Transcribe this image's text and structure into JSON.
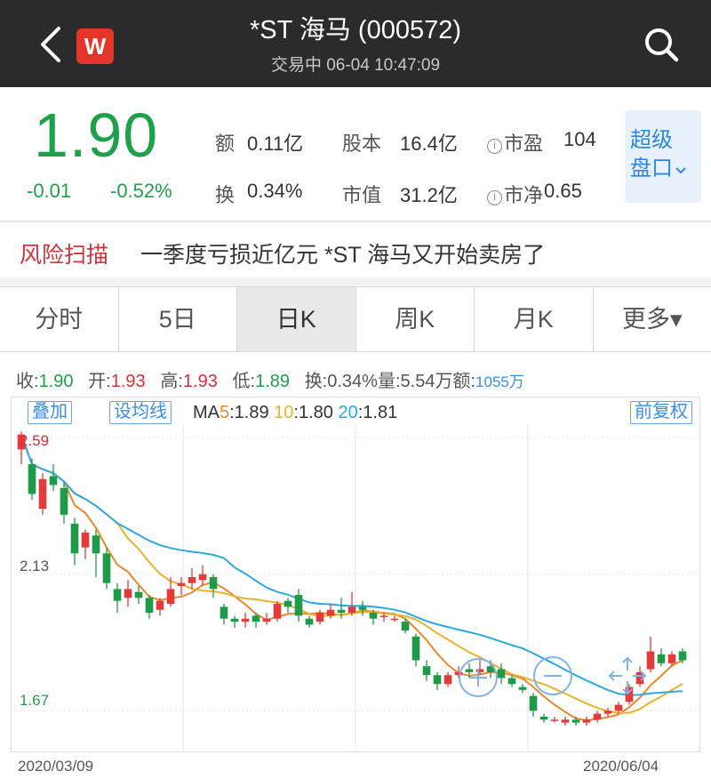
{
  "header": {
    "title": "*ST 海马 (000572)",
    "subtitle": "交易中 06-04 10:47:09",
    "logo_letter": "W"
  },
  "quote": {
    "price": "1.90",
    "change": "-0.01",
    "change_pct": "-0.52%",
    "amount_label": "额",
    "amount": "0.11亿",
    "turnover_label": "换",
    "turnover": "0.34%",
    "capital_label": "股本",
    "capital": "16.4亿",
    "mktcap_label": "市值",
    "mktcap": "31.2亿",
    "pe_label": "市盈",
    "pe": "104",
    "pb_label": "市净",
    "pb": "0.65",
    "info_mark": "i",
    "super_line1": "超级",
    "super_line2": "盘口"
  },
  "news": {
    "tag": "风险扫描",
    "text": "一季度亏损近亿元 *ST 海马又开始卖房了"
  },
  "tabs": [
    "分时",
    "5日",
    "日K",
    "周K",
    "月K",
    "更多▾"
  ],
  "active_tab": 2,
  "stats": {
    "close_label": "收:",
    "close": "1.90",
    "open_label": "开:",
    "open": "1.93",
    "high_label": "高:",
    "high": "1.93",
    "low_label": "低:",
    "low": "1.89",
    "turn_label": "换:",
    "turn": "0.34%",
    "vol_label": "量:",
    "vol": "5.54万",
    "amt_label": "额:",
    "amt": "1055万"
  },
  "chart_controls": {
    "overlay": "叠加",
    "set_ma": "设均线",
    "adjust": "前复权",
    "ma_prefix": "MA",
    "ma5_label": "5",
    "ma5": ":1.89",
    "ma10_label": "10",
    "ma10": ":1.80",
    "ma20_label": "20",
    "ma20": ":1.81"
  },
  "chart_data": {
    "type": "candlestick",
    "y_ticks": [
      "2.59",
      "2.13",
      "1.67"
    ],
    "x_start": "2020/03/09",
    "x_end": "2020/06/04",
    "ylim": [
      1.56,
      2.62
    ],
    "candles": [
      [
        2.55,
        2.6,
        2.5,
        2.61
      ],
      [
        2.5,
        2.4,
        2.38,
        2.52
      ],
      [
        2.35,
        2.45,
        2.33,
        2.47
      ],
      [
        2.46,
        2.43,
        2.41,
        2.5
      ],
      [
        2.42,
        2.33,
        2.3,
        2.44
      ],
      [
        2.3,
        2.2,
        2.16,
        2.32
      ],
      [
        2.22,
        2.27,
        2.18,
        2.28
      ],
      [
        2.26,
        2.2,
        2.12,
        2.28
      ],
      [
        2.2,
        2.1,
        2.08,
        2.22
      ],
      [
        2.08,
        2.04,
        2.0,
        2.1
      ],
      [
        2.05,
        2.08,
        2.02,
        2.11
      ],
      [
        2.07,
        2.05,
        2.03,
        2.09
      ],
      [
        2.05,
        2.0,
        1.98,
        2.06
      ],
      [
        2.01,
        2.04,
        1.99,
        2.05
      ],
      [
        2.03,
        2.08,
        2.02,
        2.12
      ],
      [
        2.09,
        2.1,
        2.06,
        2.12
      ],
      [
        2.1,
        2.12,
        2.08,
        2.15
      ],
      [
        2.11,
        2.13,
        2.09,
        2.16
      ],
      [
        2.12,
        2.08,
        2.05,
        2.13
      ],
      [
        2.02,
        1.98,
        1.96,
        2.03
      ],
      [
        1.98,
        1.97,
        1.95,
        1.99
      ],
      [
        1.97,
        1.98,
        1.95,
        2.0
      ],
      [
        1.99,
        1.97,
        1.95,
        2.0
      ],
      [
        1.97,
        1.98,
        1.96,
        2.0
      ],
      [
        1.98,
        2.03,
        1.97,
        2.04
      ],
      [
        2.04,
        2.02,
        2.0,
        2.05
      ],
      [
        2.06,
        1.99,
        1.97,
        2.08
      ],
      [
        1.98,
        1.96,
        1.95,
        1.99
      ],
      [
        1.97,
        2.0,
        1.96,
        2.01
      ],
      [
        1.99,
        2.01,
        1.98,
        2.03
      ],
      [
        2.01,
        2.0,
        1.98,
        2.05
      ],
      [
        2.0,
        2.02,
        1.99,
        2.07
      ],
      [
        2.02,
        2.01,
        1.99,
        2.04
      ],
      [
        2.0,
        1.98,
        1.96,
        2.01
      ],
      [
        1.99,
        1.99,
        1.97,
        2.0
      ],
      [
        1.98,
        1.98,
        1.97,
        1.99
      ],
      [
        1.97,
        1.94,
        1.93,
        1.98
      ],
      [
        1.92,
        1.84,
        1.82,
        1.93
      ],
      [
        1.82,
        1.79,
        1.77,
        1.84
      ],
      [
        1.79,
        1.76,
        1.74,
        1.8
      ],
      [
        1.76,
        1.79,
        1.75,
        1.8
      ],
      [
        1.79,
        1.8,
        1.78,
        1.82
      ],
      [
        1.81,
        1.8,
        1.78,
        1.83
      ],
      [
        1.8,
        1.81,
        1.79,
        1.84
      ],
      [
        1.82,
        1.8,
        1.78,
        1.84
      ],
      [
        1.81,
        1.78,
        1.76,
        1.83
      ],
      [
        1.78,
        1.76,
        1.75,
        1.79
      ],
      [
        1.75,
        1.74,
        1.73,
        1.76
      ],
      [
        1.72,
        1.67,
        1.65,
        1.73
      ],
      [
        1.65,
        1.64,
        1.63,
        1.66
      ],
      [
        1.64,
        1.64,
        1.63,
        1.65
      ],
      [
        1.63,
        1.64,
        1.62,
        1.65
      ],
      [
        1.64,
        1.63,
        1.62,
        1.65
      ],
      [
        1.63,
        1.64,
        1.62,
        1.65
      ],
      [
        1.64,
        1.66,
        1.63,
        1.67
      ],
      [
        1.66,
        1.67,
        1.65,
        1.68
      ],
      [
        1.67,
        1.69,
        1.66,
        1.7
      ],
      [
        1.7,
        1.75,
        1.69,
        1.76
      ],
      [
        1.76,
        1.8,
        1.75,
        1.82
      ],
      [
        1.81,
        1.87,
        1.8,
        1.92
      ],
      [
        1.86,
        1.83,
        1.82,
        1.88
      ],
      [
        1.83,
        1.86,
        1.82,
        1.87
      ],
      [
        1.87,
        1.84,
        1.83,
        1.88
      ]
    ],
    "series": [
      {
        "name": "5",
        "color": "#e58a2d"
      },
      {
        "name": "10",
        "color": "#e6b32f"
      },
      {
        "name": "20",
        "color": "#2ea8df"
      }
    ]
  }
}
